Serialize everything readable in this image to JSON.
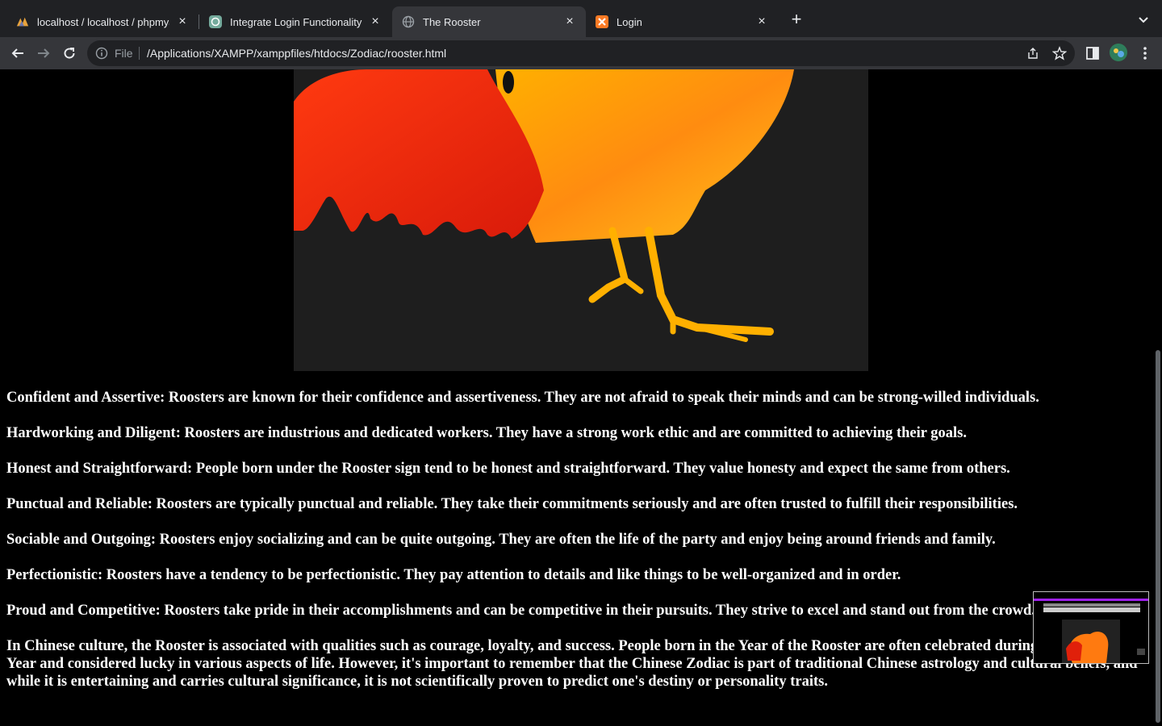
{
  "browser": {
    "tabs": [
      {
        "title": "localhost / localhost / phpmyadmin",
        "icon": "phpmyadmin-icon",
        "active": false
      },
      {
        "title": "Integrate Login Functionality",
        "icon": "chatgpt-icon",
        "active": false
      },
      {
        "title": "The Rooster",
        "icon": "globe-icon",
        "active": true
      },
      {
        "title": "Login",
        "icon": "xampp-icon",
        "active": false
      }
    ],
    "new_tab_label": "+",
    "close_glyph": "×",
    "address": {
      "scheme_label": "File",
      "url": "/Applications/XAMPP/xamppfiles/htdocs/Zodiac/rooster.html"
    }
  },
  "page": {
    "image_alt": "Rooster",
    "paragraphs": [
      "Confident and Assertive: Roosters are known for their confidence and assertiveness. They are not afraid to speak their minds and can be strong-willed individuals.",
      "Hardworking and Diligent: Roosters are industrious and dedicated workers. They have a strong work ethic and are committed to achieving their goals.",
      "Honest and Straightforward: People born under the Rooster sign tend to be honest and straightforward. They value honesty and expect the same from others.",
      "Punctual and Reliable: Roosters are typically punctual and reliable. They take their commitments seriously and are often trusted to fulfill their responsibilities.",
      "Sociable and Outgoing: Roosters enjoy socializing and can be quite outgoing. They are often the life of the party and enjoy being around friends and family.",
      "Perfectionistic: Roosters have a tendency to be perfectionistic. They pay attention to details and like things to be well-organized and in order.",
      "Proud and Competitive: Roosters take pride in their accomplishments and can be competitive in their pursuits. They strive to excel and stand out from the crowd.",
      "In Chinese culture, the Rooster is associated with qualities such as courage, loyalty, and success. People born in the Year of the Rooster are often celebrated during the Lunar New Year and considered lucky in various aspects of life. However, it's important to remember that the Chinese Zodiac is part of traditional Chinese astrology and cultural beliefs, and while it is entertaining and carries cultural significance, it is not scientifically proven to predict one's destiny or personality traits."
    ]
  },
  "colors": {
    "page_background": "#000000",
    "text": "#ffffff",
    "tabstrip": "#202124",
    "toolbar": "#35363a"
  }
}
